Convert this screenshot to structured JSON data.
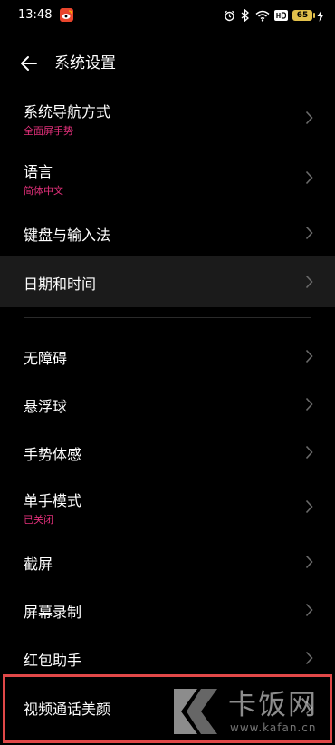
{
  "status_bar": {
    "time": "13:48",
    "battery": "65"
  },
  "header": {
    "title": "系统设置"
  },
  "items": [
    {
      "label": "系统导航方式",
      "sub": "全面屏手势"
    },
    {
      "label": "语言",
      "sub": "简体中文"
    },
    {
      "label": "键盘与输入法"
    },
    {
      "label": "日期和时间"
    },
    {
      "label": "无障碍"
    },
    {
      "label": "悬浮球"
    },
    {
      "label": "手势体感"
    },
    {
      "label": "单手模式",
      "sub": "已关闭"
    },
    {
      "label": "截屏"
    },
    {
      "label": "屏幕录制"
    },
    {
      "label": "红包助手"
    },
    {
      "label": "视频通话美颜"
    }
  ],
  "watermark": {
    "brand": "卡饭网",
    "url": "www.kafan.cn"
  },
  "colors": {
    "background": "#000000",
    "highlight_row": "#1b1b1b",
    "subtitle_accent": "#e2307a",
    "annotation_frame": "#e04848",
    "battery": "#e2c04b"
  },
  "icons": [
    "weibo-icon",
    "alarm-icon",
    "bluetooth-icon",
    "wifi-icon",
    "hd-icon",
    "battery-icon",
    "charging-icon",
    "back-arrow-icon",
    "chevron-right-icon"
  ]
}
